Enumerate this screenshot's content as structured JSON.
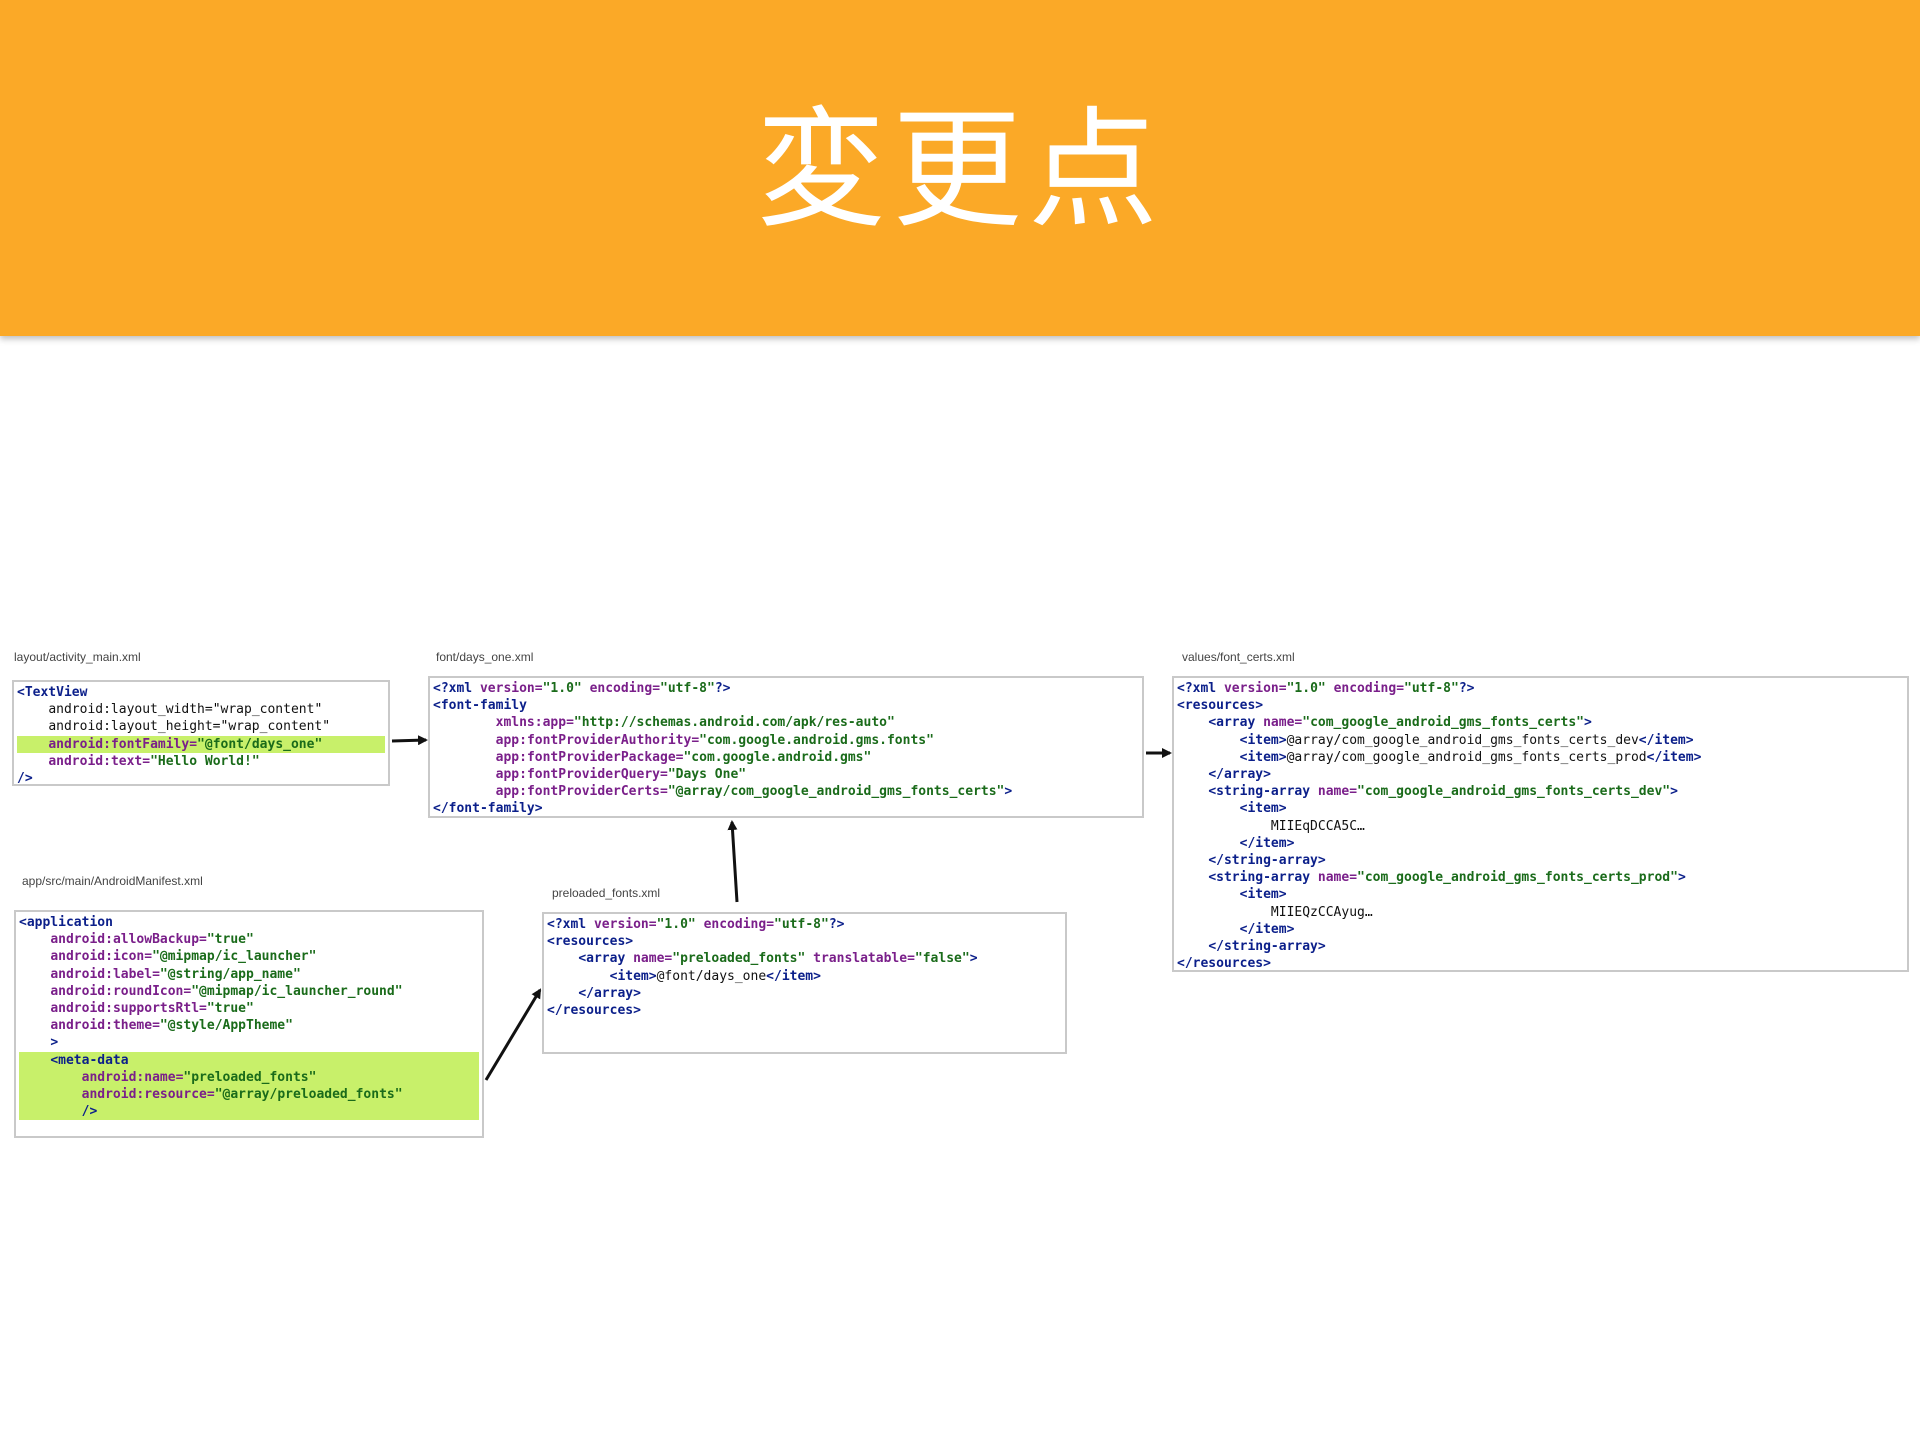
{
  "slide": {
    "title": "変更点"
  },
  "files": {
    "activity_main": {
      "label": "layout/activity_main.xml",
      "lines": [
        {
          "t": "<TextView",
          "kind": "tag",
          "hl": false
        },
        {
          "t": "    android:layout_width=\"wrap_content\"",
          "kind": "attr",
          "hl": false
        },
        {
          "t": "    android:layout_height=\"wrap_content\"",
          "kind": "attr",
          "hl": false
        },
        {
          "t": "    android:fontFamily=\"@font/days_one\"",
          "kind": "attr",
          "hl": true
        },
        {
          "t": "    android:text=\"Hello World!\"",
          "kind": "attr",
          "hl": false
        },
        {
          "t": "/>",
          "kind": "tag",
          "hl": false
        }
      ]
    },
    "days_one": {
      "label": "font/days_one.xml",
      "lines": [
        {
          "t": "<?xml version=\"1.0\" encoding=\"utf-8\"?>",
          "kind": "pi",
          "hl": false
        },
        {
          "t": "<font-family",
          "kind": "tag",
          "hl": false
        },
        {
          "t": "        xmlns:app=\"http://schemas.android.com/apk/res-auto\"",
          "kind": "attr",
          "hl": false
        },
        {
          "t": "        app:fontProviderAuthority=\"com.google.android.gms.fonts\"",
          "kind": "attr",
          "hl": false
        },
        {
          "t": "        app:fontProviderPackage=\"com.google.android.gms\"",
          "kind": "attr",
          "hl": false
        },
        {
          "t": "        app:fontProviderQuery=\"Days One\"",
          "kind": "attr",
          "hl": false
        },
        {
          "t": "        app:fontProviderCerts=\"@array/com_google_android_gms_fonts_certs\">",
          "kind": "attr",
          "hl": false
        },
        {
          "t": "</font-family>",
          "kind": "tag",
          "hl": false
        }
      ]
    },
    "font_certs": {
      "label": "values/font_certs.xml",
      "lines": [
        {
          "t": "<?xml version=\"1.0\" encoding=\"utf-8\"?>",
          "kind": "pi",
          "hl": false
        },
        {
          "t": "<resources>",
          "kind": "tag",
          "hl": false
        },
        {
          "t": "    <array name=\"com_google_android_gms_fonts_certs\">",
          "kind": "tag",
          "hl": false
        },
        {
          "t": "        <item>@array/com_google_android_gms_fonts_certs_dev</item>",
          "kind": "tag",
          "hl": false
        },
        {
          "t": "        <item>@array/com_google_android_gms_fonts_certs_prod</item>",
          "kind": "tag",
          "hl": false
        },
        {
          "t": "    </array>",
          "kind": "tag",
          "hl": false
        },
        {
          "t": "    <string-array name=\"com_google_android_gms_fonts_certs_dev\">",
          "kind": "tag",
          "hl": false
        },
        {
          "t": "        <item>",
          "kind": "tag",
          "hl": false
        },
        {
          "t": "            MIIEqDCCA5C…",
          "kind": "txt",
          "hl": false
        },
        {
          "t": "        </item>",
          "kind": "tag",
          "hl": false
        },
        {
          "t": "    </string-array>",
          "kind": "tag",
          "hl": false
        },
        {
          "t": "    <string-array name=\"com_google_android_gms_fonts_certs_prod\">",
          "kind": "tag",
          "hl": false
        },
        {
          "t": "        <item>",
          "kind": "tag",
          "hl": false
        },
        {
          "t": "            MIIEQzCCAyug…",
          "kind": "txt",
          "hl": false
        },
        {
          "t": "        </item>",
          "kind": "tag",
          "hl": false
        },
        {
          "t": "    </string-array>",
          "kind": "tag",
          "hl": false
        },
        {
          "t": "</resources>",
          "kind": "tag",
          "hl": false
        }
      ]
    },
    "manifest": {
      "label": "app/src/main/AndroidManifest.xml",
      "lines": [
        {
          "t": "<application",
          "kind": "tag",
          "hl": false
        },
        {
          "t": "    android:allowBackup=\"true\"",
          "kind": "attr",
          "hl": false
        },
        {
          "t": "    android:icon=\"@mipmap/ic_launcher\"",
          "kind": "attr",
          "hl": false
        },
        {
          "t": "    android:label=\"@string/app_name\"",
          "kind": "attr",
          "hl": false
        },
        {
          "t": "    android:roundIcon=\"@mipmap/ic_launcher_round\"",
          "kind": "attr",
          "hl": false
        },
        {
          "t": "    android:supportsRtl=\"true\"",
          "kind": "attr",
          "hl": false
        },
        {
          "t": "    android:theme=\"@style/AppTheme\"",
          "kind": "attr",
          "hl": false
        },
        {
          "t": "    >",
          "kind": "tag",
          "hl": false
        },
        {
          "t": "    <meta-data",
          "kind": "tag",
          "hl": true
        },
        {
          "t": "        android:name=\"preloaded_fonts\"",
          "kind": "attr",
          "hl": true
        },
        {
          "t": "        android:resource=\"@array/preloaded_fonts\"",
          "kind": "attr",
          "hl": true
        },
        {
          "t": "        />",
          "kind": "tag",
          "hl": true
        }
      ]
    },
    "preloaded_fonts": {
      "label": "preloaded_fonts.xml",
      "lines": [
        {
          "t": "<?xml version=\"1.0\" encoding=\"utf-8\"?>",
          "kind": "pi",
          "hl": false
        },
        {
          "t": "<resources>",
          "kind": "tag",
          "hl": false
        },
        {
          "t": "    <array name=\"preloaded_fonts\" translatable=\"false\">",
          "kind": "tag",
          "hl": false
        },
        {
          "t": "        <item>@font/days_one</item>",
          "kind": "tag",
          "hl": false
        },
        {
          "t": "    </array>",
          "kind": "tag",
          "hl": false
        },
        {
          "t": "</resources>",
          "kind": "tag",
          "hl": false
        }
      ]
    }
  },
  "colors": {
    "header": "#fba927",
    "highlight": "#c8f06a",
    "arrow": "#111111"
  }
}
